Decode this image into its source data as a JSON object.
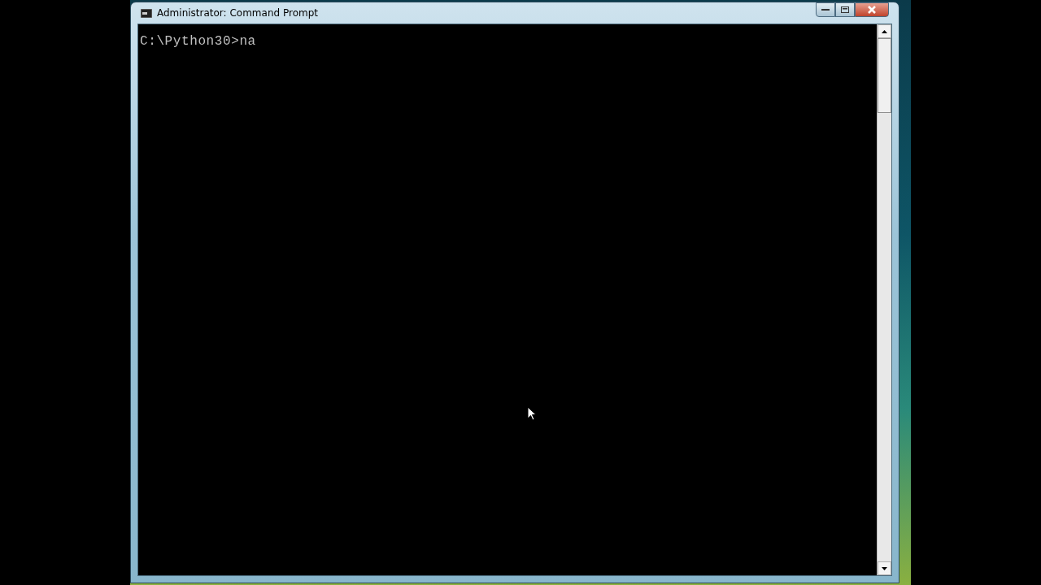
{
  "window": {
    "title": "Administrator: Command Prompt"
  },
  "console": {
    "lines": [
      "C:\\Python30>na"
    ]
  }
}
